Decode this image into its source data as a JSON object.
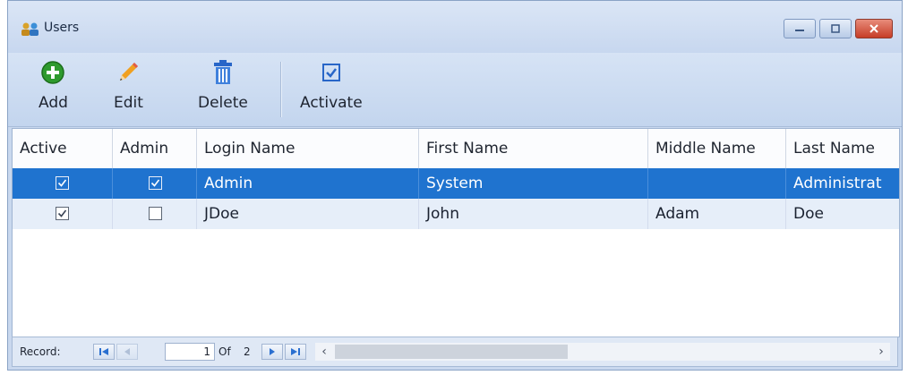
{
  "window": {
    "title": "Users",
    "controls": [
      "minimize",
      "maximize",
      "close"
    ]
  },
  "toolbar": {
    "add_label": "Add",
    "edit_label": "Edit",
    "delete_label": "Delete",
    "activate_label": "Activate"
  },
  "grid": {
    "columns": [
      "Active",
      "Admin",
      "Login Name",
      "First Name",
      "Middle Name",
      "Last Name"
    ],
    "rows": [
      {
        "active": true,
        "admin": true,
        "login": "Admin",
        "first": "System",
        "middle": "",
        "last": "Administrat",
        "selected": true
      },
      {
        "active": true,
        "admin": false,
        "login": "JDoe",
        "first": "John",
        "middle": "Adam",
        "last": "Doe",
        "selected": false
      }
    ]
  },
  "navigator": {
    "label": "Record:",
    "current": "1",
    "of_label": "Of",
    "total": "2"
  },
  "colors": {
    "selection": "#1f73cf",
    "alt_row": "#e6eef9",
    "add_icon": "#2e9a2e",
    "edit_icon": "#f0a020",
    "delete_icon": "#2866c8",
    "activate_icon": "#2866c8"
  }
}
